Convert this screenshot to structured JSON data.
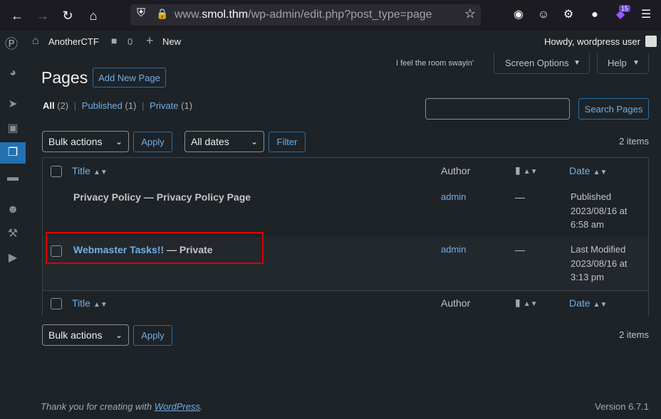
{
  "browser": {
    "url_prefix": "www.",
    "url_host": "smol.thm",
    "url_path": "/wp-admin/edit.php?post_type=page",
    "badge_count": "15"
  },
  "adminbar": {
    "site_name": "AnotherCTF",
    "comments_count": "0",
    "new_label": "New",
    "howdy": "Howdy, wordpress user"
  },
  "header": {
    "title": "Pages",
    "add_new": "Add New Page",
    "tagline": "I feel the room swayin'",
    "screen_options": "Screen Options",
    "help": "Help"
  },
  "filters": {
    "all_label": "All",
    "all_count": "(2)",
    "published_label": "Published",
    "published_count": "(1)",
    "private_label": "Private",
    "private_count": "(1)",
    "separator": "|"
  },
  "search": {
    "value": "",
    "button": "Search Pages"
  },
  "toolbar": {
    "bulk_actions": "Bulk actions",
    "apply": "Apply",
    "all_dates": "All dates",
    "filter": "Filter",
    "items": "2 items"
  },
  "table": {
    "columns": {
      "title": "Title",
      "author": "Author",
      "date": "Date"
    },
    "rows": [
      {
        "title": "Privacy Policy",
        "state": "— Privacy Policy Page",
        "author": "admin",
        "comments": "—",
        "date_status": "Published",
        "date_line1": "2023/08/16 at",
        "date_line2": "6:58 am"
      },
      {
        "title": "Webmaster Tasks!!",
        "state": "— Private",
        "author": "admin",
        "comments": "—",
        "date_status": "Last Modified",
        "date_line1": "2023/08/16 at",
        "date_line2": "3:13 pm"
      }
    ]
  },
  "footer": {
    "thanks_prefix": "Thank you for creating with ",
    "thanks_link": "WordPress",
    "thanks_suffix": ".",
    "version": "Version 6.7.1"
  }
}
